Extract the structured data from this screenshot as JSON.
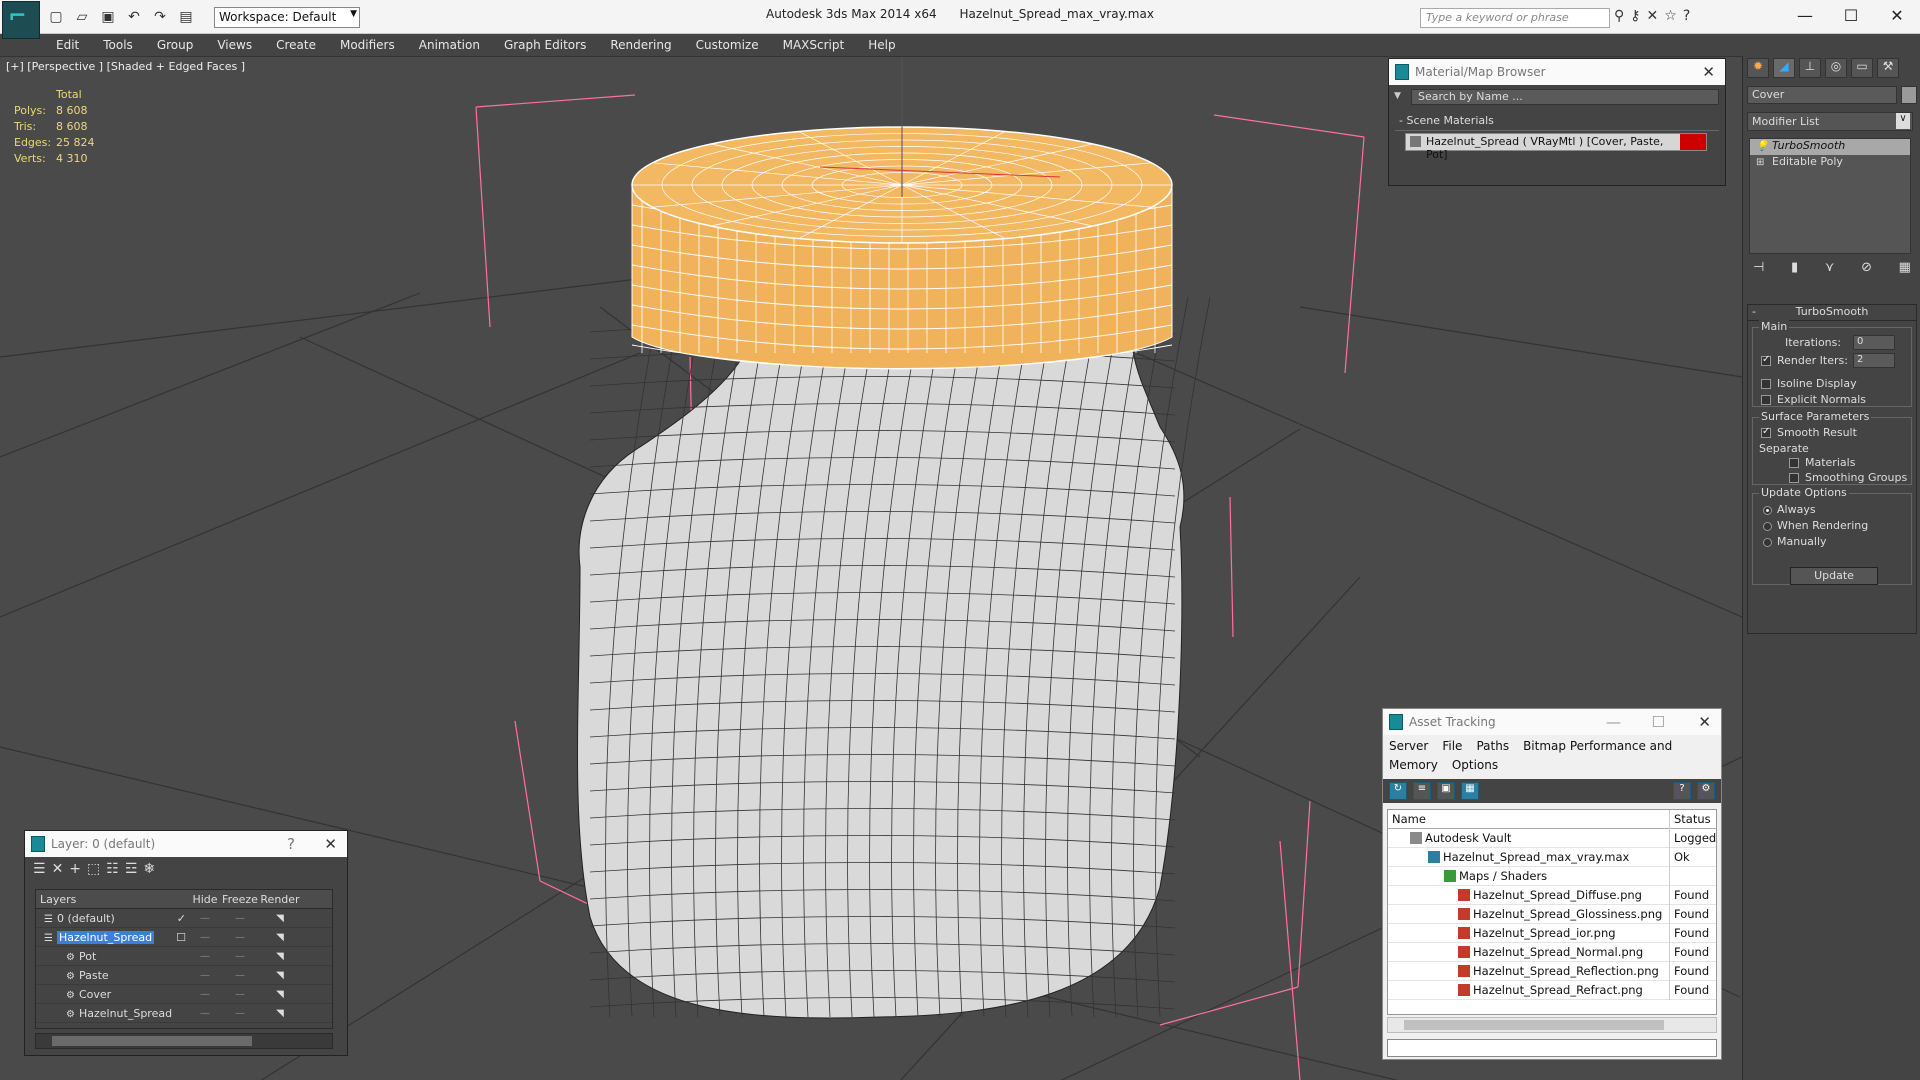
{
  "titlebar": {
    "app": "Autodesk 3ds Max  2014 x64",
    "file": "Hazelnut_Spread_max_vray.max",
    "workspace": "Workspace: Default",
    "search_placeholder": "Type a keyword or phrase"
  },
  "menu": [
    "Edit",
    "Tools",
    "Group",
    "Views",
    "Create",
    "Modifiers",
    "Animation",
    "Graph Editors",
    "Rendering",
    "Customize",
    "MAXScript",
    "Help"
  ],
  "viewport": {
    "label": "[+] [Perspective ] [Shaded + Edged Faces ]",
    "stats_header": "Total",
    "stats": [
      {
        "k": "Polys:",
        "v": "8 608"
      },
      {
        "k": "Tris:",
        "v": "8 608"
      },
      {
        "k": "Edges:",
        "v": "25 824"
      },
      {
        "k": "Verts:",
        "v": "4 310"
      }
    ],
    "colors": {
      "bg": "#4a4a4a",
      "lid": "#f0b35c",
      "jar": "#d9d9d9",
      "bbox": "#ff6fa0"
    }
  },
  "material_browser": {
    "title": "Material/Map Browser",
    "search": "Search by Name ...",
    "section": "- Scene Materials",
    "item": "Hazelnut_Spread  ( VRayMtl ) [Cover, Paste, Pot]"
  },
  "command_panel": {
    "object_name": "Cover",
    "modifier_list": "Modifier List",
    "stack": [
      "TurboSmooth",
      "Editable Poly"
    ],
    "rollout_title": "TurboSmooth",
    "main_label": "Main",
    "iterations_label": "Iterations:",
    "iterations": "0",
    "render_iters_label": "Render Iters:",
    "render_iters": "2",
    "isoline": "Isoline Display",
    "explicit": "Explicit Normals",
    "surface_label": "Surface Parameters",
    "smooth_result": "Smooth Result",
    "separate": "Separate",
    "materials": "Materials",
    "smoothing_groups": "Smoothing Groups",
    "update_options": "Update Options",
    "always": "Always",
    "when_rendering": "When Rendering",
    "manually": "Manually",
    "update_btn": "Update"
  },
  "layer_window": {
    "title": "Layer: 0 (default)",
    "help": "?",
    "cols": [
      "Layers",
      "Hide",
      "Freeze",
      "Render"
    ],
    "rows": [
      {
        "name": "0 (default)",
        "indent": 0
      },
      {
        "name": "Hazelnut_Spread",
        "indent": 0
      },
      {
        "name": "Pot",
        "indent": 1
      },
      {
        "name": "Paste",
        "indent": 1
      },
      {
        "name": "Cover",
        "indent": 1
      },
      {
        "name": "Hazelnut_Spread",
        "indent": 1
      }
    ]
  },
  "asset_tracking": {
    "title": "Asset Tracking",
    "menu": [
      "Server",
      "File",
      "Paths",
      "Bitmap Performance and Memory",
      "Options"
    ],
    "cols": [
      "Name",
      "Status"
    ],
    "rows": [
      {
        "name": "Autodesk Vault",
        "status": "Logged",
        "indent": 1
      },
      {
        "name": "Hazelnut_Spread_max_vray.max",
        "status": "Ok",
        "indent": 2
      },
      {
        "name": "Maps / Shaders",
        "status": "",
        "indent": 3
      },
      {
        "name": "Hazelnut_Spread_Diffuse.png",
        "status": "Found",
        "indent": 4
      },
      {
        "name": "Hazelnut_Spread_Glossiness.png",
        "status": "Found",
        "indent": 4
      },
      {
        "name": "Hazelnut_Spread_ior.png",
        "status": "Found",
        "indent": 4
      },
      {
        "name": "Hazelnut_Spread_Normal.png",
        "status": "Found",
        "indent": 4
      },
      {
        "name": "Hazelnut_Spread_Reflection.png",
        "status": "Found",
        "indent": 4
      },
      {
        "name": "Hazelnut_Spread_Refract.png",
        "status": "Found",
        "indent": 4
      }
    ]
  }
}
